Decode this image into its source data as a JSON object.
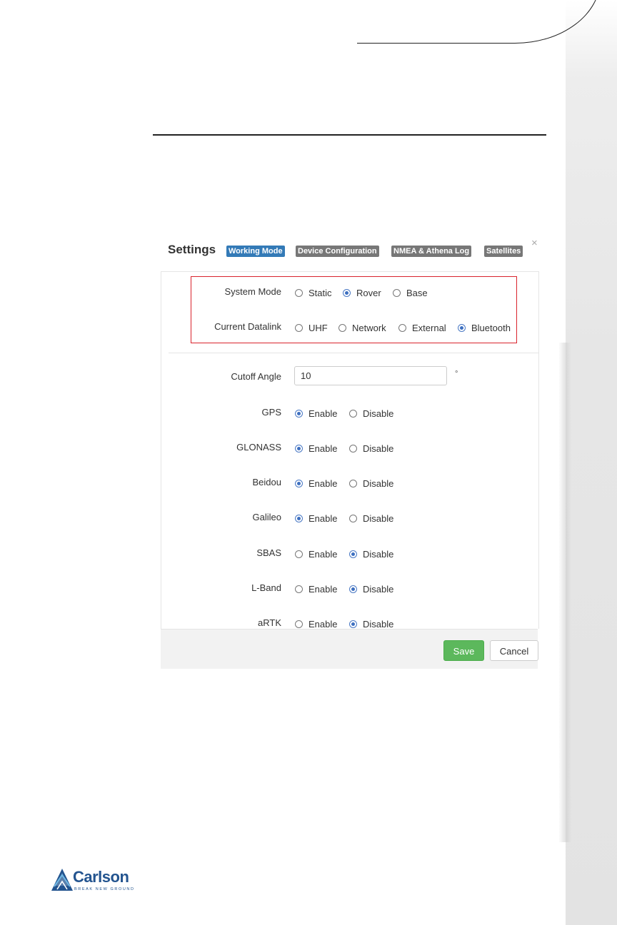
{
  "dialog": {
    "title": "Settings",
    "tabs": [
      {
        "label": "Working Mode",
        "active": true
      },
      {
        "label": "Device Configuration",
        "active": false
      },
      {
        "label": "NMEA & Athena Log",
        "active": false
      },
      {
        "label": "Satellites",
        "active": false
      }
    ],
    "close_icon": "×",
    "system_mode": {
      "label": "System Mode",
      "options": [
        "Static",
        "Rover",
        "Base"
      ],
      "selected": "Rover"
    },
    "current_datalink": {
      "label": "Current Datalink",
      "options": [
        "UHF",
        "Network",
        "External",
        "Bluetooth"
      ],
      "selected": "Bluetooth"
    },
    "cutoff_angle": {
      "label": "Cutoff Angle",
      "value": "10",
      "unit": "°"
    },
    "constellations": [
      {
        "label": "GPS",
        "enable": "Enable",
        "disable": "Disable",
        "selected": "Enable"
      },
      {
        "label": "GLONASS",
        "enable": "Enable",
        "disable": "Disable",
        "selected": "Enable"
      },
      {
        "label": "Beidou",
        "enable": "Enable",
        "disable": "Disable",
        "selected": "Enable"
      },
      {
        "label": "Galileo",
        "enable": "Enable",
        "disable": "Disable",
        "selected": "Enable"
      },
      {
        "label": "SBAS",
        "enable": "Enable",
        "disable": "Disable",
        "selected": "Disable"
      },
      {
        "label": "L-Band",
        "enable": "Enable",
        "disable": "Disable",
        "selected": "Disable"
      },
      {
        "label": "aRTK",
        "enable": "Enable",
        "disable": "Disable",
        "selected": "Disable"
      }
    ],
    "save_label": "Save",
    "cancel_label": "Cancel"
  },
  "logo": {
    "name": "Carlson",
    "tagline": "BREAK NEW GROUND"
  },
  "colors": {
    "active_tab": "#337ab7",
    "inactive_tab": "#777777",
    "highlight_box": "#d9232d",
    "save_button": "#5cb85c",
    "radio_selected": "#3d6fc0",
    "logo_blue": "#23548f"
  }
}
